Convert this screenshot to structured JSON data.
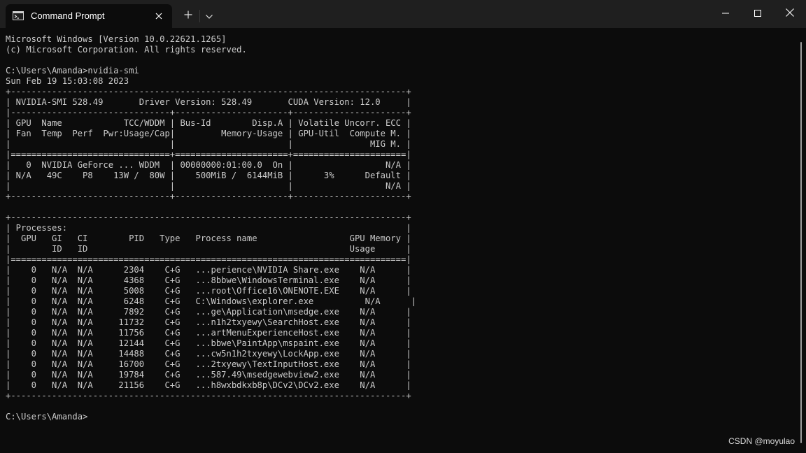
{
  "titlebar": {
    "tab_title": "Command Prompt",
    "tab_icon": "command-prompt-icon",
    "tab_close_icon": "close-icon",
    "new_tab_icon": "plus-icon",
    "dropdown_icon": "chevron-down-icon",
    "minimize_icon": "minimize-icon",
    "maximize_icon": "maximize-icon",
    "close_window_icon": "close-icon"
  },
  "colors": {
    "background": "#0c0c0c",
    "titlebar": "#1f1f1f",
    "text": "#cccccc"
  },
  "terminal": {
    "output": "Microsoft Windows [Version 10.0.22621.1265]\n(c) Microsoft Corporation. All rights reserved.\n\nC:\\Users\\Amanda>nvidia-smi\nSun Feb 19 15:03:08 2023\n+-----------------------------------------------------------------------------+\n| NVIDIA-SMI 528.49       Driver Version: 528.49       CUDA Version: 12.0     |\n|-------------------------------+----------------------+----------------------+\n| GPU  Name            TCC/WDDM | Bus-Id        Disp.A | Volatile Uncorr. ECC |\n| Fan  Temp  Perf  Pwr:Usage/Cap|         Memory-Usage | GPU-Util  Compute M. |\n|                               |                      |               MIG M. |\n|===============================+======================+======================|\n|   0  NVIDIA GeForce ... WDDM  | 00000000:01:00.0  On |                  N/A |\n| N/A   49C    P8    13W /  80W |    500MiB /  6144MiB |      3%      Default |\n|                               |                      |                  N/A |\n+-------------------------------+----------------------+----------------------+\n\n+-----------------------------------------------------------------------------+\n| Processes:                                                                  |\n|  GPU   GI   CI        PID   Type   Process name                  GPU Memory |\n|        ID   ID                                                   Usage      |\n|=============================================================================|\n|    0   N/A  N/A      2304    C+G   ...perience\\NVIDIA Share.exe    N/A      |\n|    0   N/A  N/A      4368    C+G   ...8bbwe\\WindowsTerminal.exe    N/A      |\n|    0   N/A  N/A      5008    C+G   ...root\\Office16\\ONENOTE.EXE    N/A      |\n|    0   N/A  N/A      6248    C+G   C:\\Windows\\explorer.exe          N/A      |\n|    0   N/A  N/A      7892    C+G   ...ge\\Application\\msedge.exe    N/A      |\n|    0   N/A  N/A     11732    C+G   ...n1h2txyewy\\SearchHost.exe    N/A      |\n|    0   N/A  N/A     11756    C+G   ...artMenuExperienceHost.exe    N/A      |\n|    0   N/A  N/A     12144    C+G   ...bbwe\\PaintApp\\mspaint.exe    N/A      |\n|    0   N/A  N/A     14488    C+G   ...cw5n1h2txyewy\\LockApp.exe    N/A      |\n|    0   N/A  N/A     16700    C+G   ...2txyewy\\TextInputHost.exe    N/A      |\n|    0   N/A  N/A     19784    C+G   ...587.49\\msedgewebview2.exe    N/A      |\n|    0   N/A  N/A     21156    C+G   ...h8wxbdkxb8p\\DCv2\\DCv2.exe    N/A      |\n+-----------------------------------------------------------------------------+\n\nC:\\Users\\Amanda>"
  },
  "watermark": "CSDN @moyulao"
}
